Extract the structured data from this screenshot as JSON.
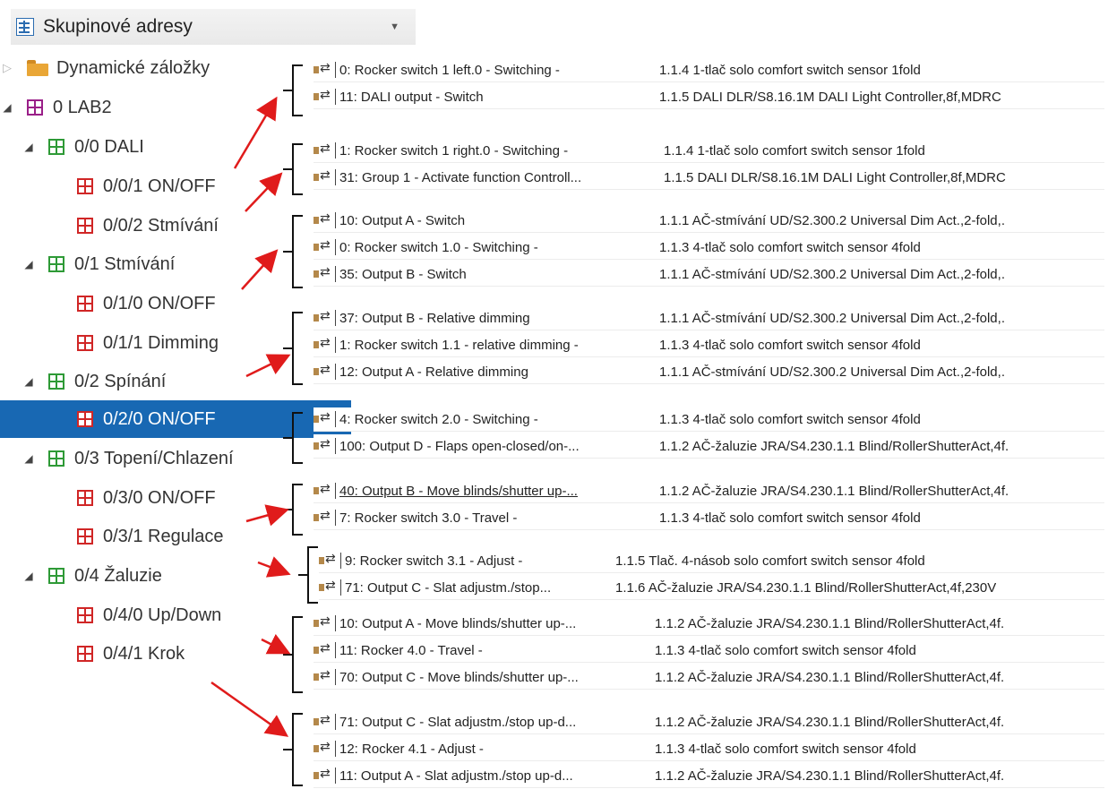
{
  "header": {
    "title": "Skupinové adresy",
    "caret": "▼"
  },
  "tree": [
    {
      "label": "Dynamické záložky",
      "type": "folder",
      "expander": "▷"
    },
    {
      "label": "0 LAB2",
      "type": "purple",
      "expander": "◢"
    },
    {
      "label": "0/0 DALI",
      "type": "green",
      "expander": "◢"
    },
    {
      "label": "0/0/1 ON/OFF",
      "type": "red"
    },
    {
      "label": "0/0/2 Stmívání",
      "type": "red"
    },
    {
      "label": "0/1 Stmívání",
      "type": "green",
      "expander": "◢"
    },
    {
      "label": "0/1/0 ON/OFF",
      "type": "red"
    },
    {
      "label": "0/1/1 Dimming",
      "type": "red"
    },
    {
      "label": "0/2 Spínání",
      "type": "green",
      "expander": "◢"
    },
    {
      "label": "0/2/0 ON/OFF",
      "type": "red",
      "selected": true
    },
    {
      "label": "0/3 Topení/Chlazení",
      "type": "green",
      "expander": "◢"
    },
    {
      "label": "0/3/0 ON/OFF",
      "type": "red"
    },
    {
      "label": "0/3/1 Regulace",
      "type": "red"
    },
    {
      "label": "0/4 Žaluzie",
      "type": "green",
      "expander": "◢"
    },
    {
      "label": "0/4/0 Up/Down",
      "type": "red"
    },
    {
      "label": "0/4/1 Krok",
      "type": "red"
    }
  ],
  "panels": [
    {
      "rows": [
        {
          "obj": "0: Rocker switch 1 left.0 - Switching -",
          "dev": "1.1.4 1-tlač solo comfort switch sensor 1fold"
        },
        {
          "obj": "11: DALI output - Switch",
          "dev": "1.1.5 DALI DLR/S8.16.1M DALI Light Controller,8f,MDRC"
        }
      ]
    },
    {
      "rows": [
        {
          "obj": "1: Rocker switch 1 right.0 - Switching -",
          "dev": "1.1.4 1-tlač solo comfort switch sensor 1fold"
        },
        {
          "obj": "31: Group 1 - Activate function Controll...",
          "dev": "1.1.5 DALI DLR/S8.16.1M DALI Light Controller,8f,MDRC"
        }
      ]
    },
    {
      "rows": [
        {
          "obj": "10: Output A - Switch",
          "dev": "1.1.1 AČ-stmívání UD/S2.300.2 Universal Dim Act.,2-fold,."
        },
        {
          "obj": "0: Rocker switch 1.0 - Switching -",
          "dev": "1.1.3 4-tlač solo comfort switch sensor 4fold"
        },
        {
          "obj": "35: Output B - Switch",
          "dev": "1.1.1 AČ-stmívání UD/S2.300.2 Universal Dim Act.,2-fold,."
        }
      ]
    },
    {
      "rows": [
        {
          "obj": "37: Output B - Relative dimming",
          "dev": "1.1.1 AČ-stmívání UD/S2.300.2 Universal Dim Act.,2-fold,."
        },
        {
          "obj": "1: Rocker switch 1.1 - relative dimming -",
          "dev": "1.1.3 4-tlač solo comfort switch sensor 4fold"
        },
        {
          "obj": "12: Output A - Relative dimming",
          "dev": "1.1.1 AČ-stmívání UD/S2.300.2 Universal Dim Act.,2-fold,."
        }
      ]
    },
    {
      "rows": [
        {
          "obj": "4: Rocker switch 2.0 - Switching -",
          "dev": "1.1.3 4-tlač solo comfort switch sensor 4fold"
        },
        {
          "obj": "100: Output D - Flaps open-closed/on-...",
          "dev": "1.1.2 AČ-žaluzie JRA/S4.230.1.1 Blind/RollerShutterAct,4f."
        }
      ]
    },
    {
      "rows": [
        {
          "obj": "40: Output B - Move blinds/shutter up-...",
          "dev": "1.1.2 AČ-žaluzie JRA/S4.230.1.1 Blind/RollerShutterAct,4f.",
          "underline": true
        },
        {
          "obj": "7: Rocker switch 3.0 - Travel -",
          "dev": "1.1.3 4-tlač solo comfort switch sensor 4fold"
        }
      ]
    },
    {
      "rows": [
        {
          "obj": "9: Rocker switch 3.1 - Adjust -",
          "dev": "1.1.5 Tlač. 4-násob solo comfort switch sensor 4fold"
        },
        {
          "obj": "71: Output C - Slat adjustm./stop...",
          "dev": "1.1.6 AČ-žaluzie JRA/S4.230.1.1 Blind/RollerShutterAct,4f,230V"
        }
      ]
    },
    {
      "rows": [
        {
          "obj": "10: Output A - Move blinds/shutter up-...",
          "dev": "1.1.2 AČ-žaluzie JRA/S4.230.1.1 Blind/RollerShutterAct,4f."
        },
        {
          "obj": "11: Rocker 4.0 - Travel -",
          "dev": "1.1.3 4-tlač solo comfort switch sensor 4fold"
        },
        {
          "obj": "70: Output C - Move blinds/shutter up-...",
          "dev": "1.1.2 AČ-žaluzie JRA/S4.230.1.1 Blind/RollerShutterAct,4f."
        }
      ]
    },
    {
      "rows": [
        {
          "obj": "71: Output C - Slat adjustm./stop up-d...",
          "dev": "1.1.2 AČ-žaluzie JRA/S4.230.1.1 Blind/RollerShutterAct,4f."
        },
        {
          "obj": "12: Rocker 4.1 - Adjust -",
          "dev": "1.1.3 4-tlač solo comfort switch sensor 4fold"
        },
        {
          "obj": "11: Output A - Slat adjustm./stop up-d...",
          "dev": "1.1.2 AČ-žaluzie JRA/S4.230.1.1 Blind/RollerShutterAct,4f."
        }
      ]
    }
  ],
  "colors": {
    "selected": "#1868b3",
    "arrow": "#e01b1b",
    "groupRed": "#d02626",
    "groupGreen": "#2e9a36"
  }
}
